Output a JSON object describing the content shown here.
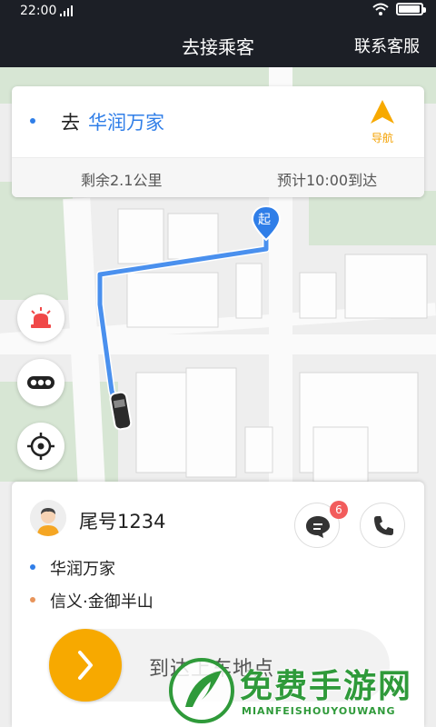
{
  "status_bar": {
    "time": "22:00",
    "battery_level": 0.95
  },
  "header": {
    "title": "去接乘客",
    "service_label": "联系客服"
  },
  "destination": {
    "prefix": "去",
    "place": "华润万家",
    "nav_label": "导航",
    "remaining": "剩余2.1公里",
    "eta": "预计10:00到达"
  },
  "map": {
    "start_marker": "起"
  },
  "passenger": {
    "tail_number": "尾号1234",
    "message_badge": "6",
    "pickup": "华润万家",
    "dropoff": "信义·金御半山"
  },
  "slider": {
    "label": "到达上车地点"
  },
  "watermark": {
    "brand": "免费手游网",
    "sub": "MIANFEISHOUYOUWANG"
  },
  "colors": {
    "accent_blue": "#2f7ee8",
    "accent_orange": "#f7a900",
    "badge_red": "#f25c5c",
    "brand_green": "#2f9a3a"
  },
  "icons": [
    "signal-icon",
    "wifi-icon",
    "battery-icon",
    "navigation-arrow-icon",
    "alarm-light-icon",
    "more-dots-icon",
    "locate-icon",
    "chat-icon",
    "phone-icon",
    "chevron-right-icon"
  ]
}
